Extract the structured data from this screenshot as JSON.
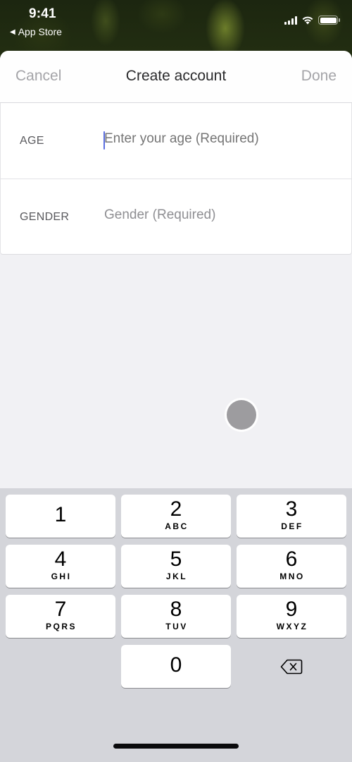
{
  "status_bar": {
    "time": "9:41",
    "back_app": "App Store",
    "back_glyph": "◀",
    "icons": [
      "cellular-signal-icon",
      "wifi-icon",
      "battery-icon"
    ]
  },
  "nav": {
    "cancel_label": "Cancel",
    "title": "Create account",
    "done_label": "Done"
  },
  "form": {
    "fields": [
      {
        "label": "AGE",
        "value": "",
        "placeholder": "Enter your age (Required)",
        "focused": true
      },
      {
        "label": "GENDER",
        "value": "",
        "placeholder": "Gender (Required)",
        "focused": false
      }
    ]
  },
  "keyboard": {
    "type": "number-pad",
    "keys": [
      {
        "num": "1",
        "letters": ""
      },
      {
        "num": "2",
        "letters": "ABC"
      },
      {
        "num": "3",
        "letters": "DEF"
      },
      {
        "num": "4",
        "letters": "GHI"
      },
      {
        "num": "5",
        "letters": "JKL"
      },
      {
        "num": "6",
        "letters": "MNO"
      },
      {
        "num": "7",
        "letters": "PQRS"
      },
      {
        "num": "8",
        "letters": "TUV"
      },
      {
        "num": "9",
        "letters": "WXYZ"
      },
      {
        "num": "0",
        "letters": ""
      }
    ],
    "delete_icon": "delete-backspace-icon"
  },
  "colors": {
    "cursor": "#5b6ee0",
    "sheet_bg": "#f1f1f4",
    "keyboard_bg": "#d4d5da",
    "nav_action": "#a4a4a8"
  }
}
